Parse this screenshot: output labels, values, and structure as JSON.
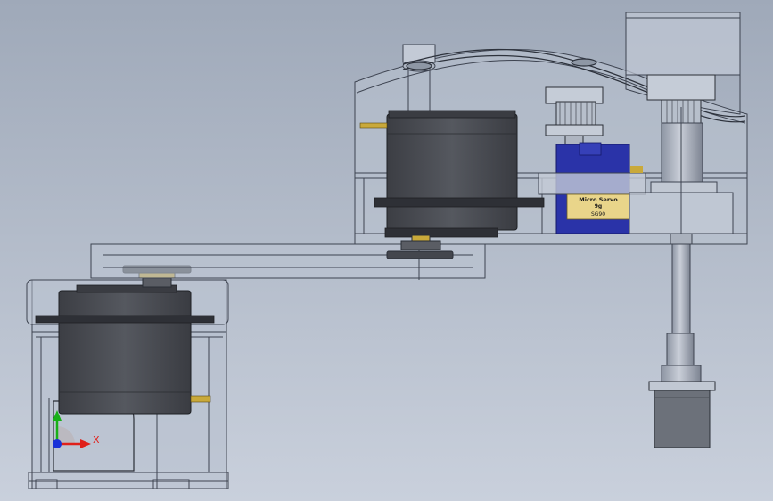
{
  "viewport": {
    "background_top": "#9fa9b9",
    "background_bottom": "#c9d0dc"
  },
  "colors": {
    "housing": "#b4bdcb",
    "housing_line": "#3d4350",
    "servo_body": "#4a4c52",
    "servo_dark": "#2e3036",
    "micro_servo": "#2a33a8",
    "micro_servo_dark": "#1a1f78",
    "label_yellow": "#e9d58a",
    "brass": "#c9a93a",
    "shaft": "#a9b0bd",
    "stepper": "#6c717a",
    "axis_x": "#e0201a",
    "axis_y": "#18b018",
    "axis_z": "#1a32d8"
  },
  "micro_servo": {
    "label_line1": "Micro Servo",
    "label_line2": "9g",
    "label_line3": "SG90"
  },
  "triad": {
    "x_label": "X"
  }
}
